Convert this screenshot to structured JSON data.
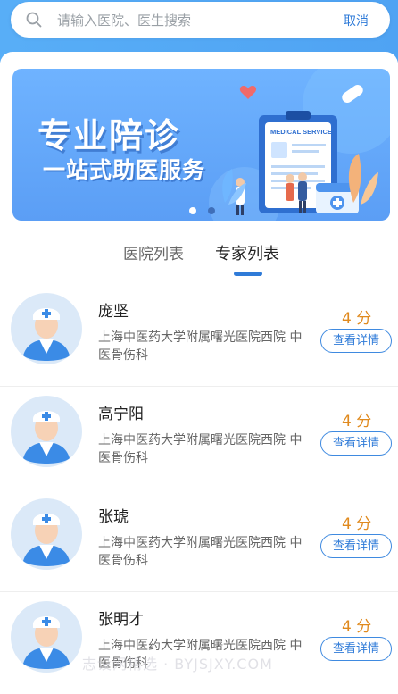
{
  "search": {
    "placeholder": "请输入医院、医生搜索",
    "cancel_label": "取消"
  },
  "banner": {
    "title": "专业陪诊",
    "subtitle": "一站式助医服务",
    "card_label": "MEDICAL SERVICE"
  },
  "tabs": [
    {
      "label": "医院列表",
      "active": false
    },
    {
      "label": "专家列表",
      "active": true
    }
  ],
  "doctors": [
    {
      "name": "庞坚",
      "hospital": "上海中医药大学附属曙光医院西院 中医骨伤科",
      "score": "4 分",
      "button": "查看详情"
    },
    {
      "name": "高宁阳",
      "hospital": "上海中医药大学附属曙光医院西院 中医骨伤科",
      "score": "4 分",
      "button": "查看详情"
    },
    {
      "name": "张琥",
      "hospital": "上海中医药大学附属曙光医院西院 中医骨伤科",
      "score": "4 分",
      "button": "查看详情"
    },
    {
      "name": "张明才",
      "hospital": "上海中医药大学附属曙光医院西院 中医骨伤科",
      "score": "4 分",
      "button": "查看详情"
    }
  ],
  "watermark": "志设网精选 · BYJSJXY.COM",
  "colors": {
    "accent": "#2f7bd8",
    "score": "#e08a1e",
    "banner": "#5b9ef5"
  }
}
